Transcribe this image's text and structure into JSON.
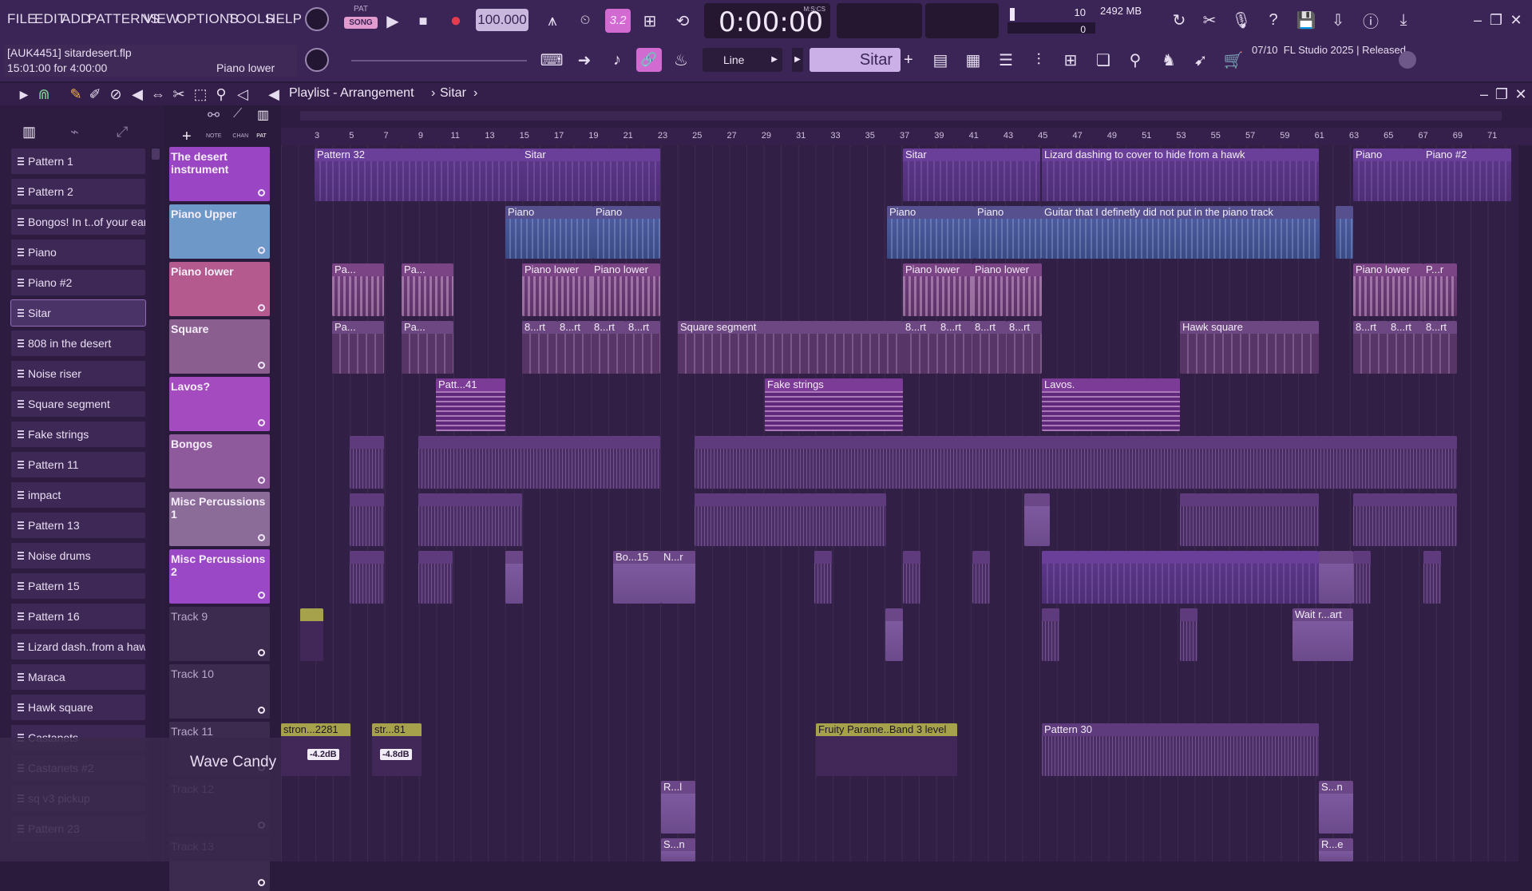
{
  "menu": [
    "FILE",
    "EDIT",
    "ADD",
    "PATTERNS",
    "VIEW",
    "OPTIONS",
    "TOOLS",
    "HELP"
  ],
  "transport": {
    "pat_label": "PAT",
    "song_label": "SONG",
    "tempo": "100.000",
    "time": "0:00:00",
    "time_unit": "M:S:CS",
    "cpu": "10",
    "memory": "2492 MB",
    "polyphony": "0",
    "snap": "3.2"
  },
  "project": {
    "file": "[AUK4451] sitardesert.flp",
    "timing": "15:01:00 for 4:00:00",
    "hint": "Piano lower"
  },
  "toolbar2": {
    "draw_mode": "Line",
    "channel": "Sitar"
  },
  "news": {
    "date": "07/10",
    "text": "FL Studio 2025 | Released"
  },
  "playlist": {
    "title": "Playlist - Arrangement",
    "crumb": "Sitar",
    "picker_tabs": [
      "NOTE",
      "CHAN",
      "PAT"
    ]
  },
  "ruler_ticks": [
    "3",
    "5",
    "7",
    "9",
    "11",
    "13",
    "15",
    "17",
    "19",
    "21",
    "23",
    "25",
    "27",
    "29",
    "31",
    "33",
    "35",
    "37",
    "39",
    "41",
    "43",
    "45",
    "47",
    "49",
    "51",
    "53",
    "55",
    "57",
    "59",
    "61",
    "63",
    "65",
    "67",
    "69",
    "71"
  ],
  "patterns": [
    "Pattern 1",
    "Pattern 2",
    "Bongos! In t..of your ears",
    "Piano",
    "Piano #2",
    "Sitar",
    "808 in the desert",
    "Noise riser",
    "Square segment",
    "Fake strings",
    "Pattern 11",
    "impact",
    "Pattern 13",
    "Noise drums",
    "Pattern 15",
    "Pattern 16",
    "Lizard dash..from a hawk",
    "Maraca",
    "Hawk square",
    "Castanets",
    "Castanets #2",
    "sq v3 pickup",
    "Pattern 23"
  ],
  "tracks": [
    {
      "name": "The desert instrument",
      "color": "#9a45c4"
    },
    {
      "name": "Piano Upper",
      "color": "#6e98c8"
    },
    {
      "name": "Piano lower",
      "color": "#b45a8e"
    },
    {
      "name": "Square",
      "color": "#8a5f90"
    },
    {
      "name": "Lavos?",
      "color": "#a54bc0"
    },
    {
      "name": "Bongos",
      "color": "#8f5a9c"
    },
    {
      "name": "Misc Percussions 1",
      "color": "#8b6c98"
    },
    {
      "name": "Misc Percussions 2",
      "color": "#9a48c6"
    },
    {
      "name": "Track 9",
      "color": "#3c2a4f"
    },
    {
      "name": "Track 10",
      "color": "#3c2a4f"
    },
    {
      "name": "Track 11",
      "color": "#3c2a4f"
    },
    {
      "name": "Track 12",
      "color": "#3c2a4f"
    },
    {
      "name": "Track 13",
      "color": "#3c2a4f"
    }
  ],
  "clip_labels": {
    "pattern32": "Pattern 32",
    "sitar": "Sitar",
    "lizard": "Lizard dashing to cover to hide from a hawk",
    "piano": "Piano",
    "piano2": "Piano #2",
    "guitar": "Guitar that I definetly did not put in the piano track",
    "piano_lower": "Piano lower",
    "pa": "Pa...",
    "p_r": "P...r",
    "b_rt": "8...rt",
    "square_segment": "Square segment",
    "hawk_square": "Hawk square",
    "patt41": "Patt...41",
    "fake_strings": "Fake strings",
    "lavos": "Lavos.",
    "bo15": "Bo...15",
    "n_r": "N...r",
    "wait_art": "Wait r...art",
    "stron": "stron...2281",
    "str81": "str...81",
    "fruity": "Fruity Parame..Band 3 level",
    "pattern30": "Pattern 30",
    "r_l": "R...l",
    "s_n": "S...n",
    "r_e": "R...e",
    "db1": "-4.2dB",
    "db2": "-4.8dB"
  },
  "overlay": {
    "wave_candy": "Wave Candy"
  }
}
